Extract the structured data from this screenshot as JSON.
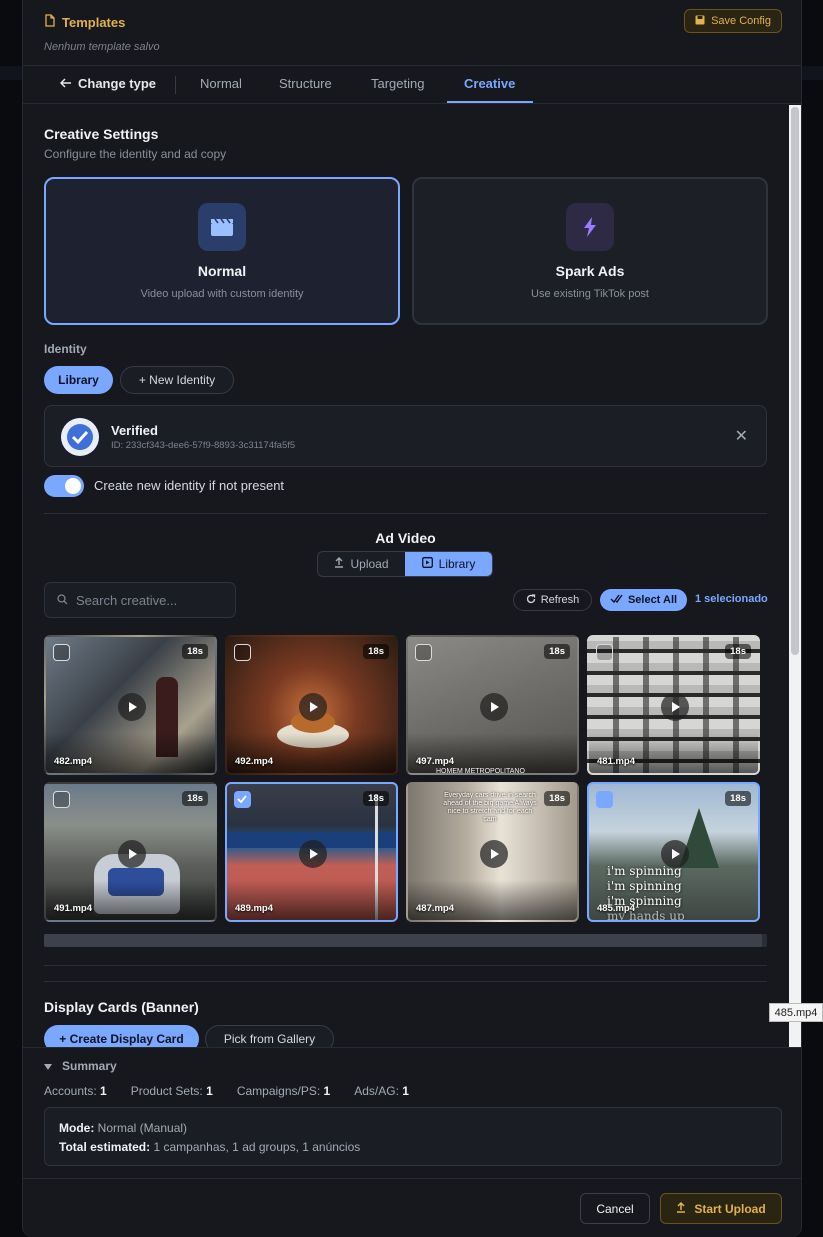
{
  "templates": {
    "title": "Templates",
    "subtitle": "Nenhum template salvo",
    "save_label": "Save Config"
  },
  "tabs": {
    "back_label": "Change type",
    "items": [
      "Normal",
      "Structure",
      "Targeting",
      "Creative"
    ],
    "active": "Creative"
  },
  "creative": {
    "title": "Creative Settings",
    "subtitle": "Configure the identity and ad copy",
    "modes": [
      {
        "name": "Normal",
        "desc": "Video upload with custom identity",
        "icon": "clapperboard-icon",
        "selected": true
      },
      {
        "name": "Spark Ads",
        "desc": "Use existing TikTok post",
        "icon": "lightning-icon",
        "selected": false
      }
    ]
  },
  "identity": {
    "label": "Identity",
    "library_label": "Library",
    "new_label": "+ New Identity",
    "name": "Verified",
    "id_text": "ID: 233cf343-dee6-57f9-8893-3c31174fa5f5",
    "toggle_label": "Create new identity if not present",
    "toggle_on": true
  },
  "ad_video": {
    "title": "Ad Video",
    "upload_label": "Upload",
    "library_label": "Library",
    "search_placeholder": "Search creative...",
    "refresh_label": "Refresh",
    "select_all_label": "Select All",
    "selected_count": "1 selecionado",
    "videos": [
      {
        "name": "482.mp4",
        "duration": "18s",
        "selected": false
      },
      {
        "name": "492.mp4",
        "duration": "18s",
        "selected": false
      },
      {
        "name": "497.mp4",
        "duration": "18s",
        "selected": false
      },
      {
        "name": "481.mp4",
        "duration": "18s",
        "selected": false
      },
      {
        "name": "491.mp4",
        "duration": "18s",
        "selected": false
      },
      {
        "name": "489.mp4",
        "duration": "18s",
        "selected": true
      },
      {
        "name": "487.mp4",
        "duration": "18s",
        "selected": false
      },
      {
        "name": "485.mp4",
        "duration": "18s",
        "selected": false
      }
    ],
    "overlay_text": {
      "i_am_spinning": [
        "i'm spinning",
        "i'm spinning",
        "i'm spinning",
        "my hands up"
      ],
      "blurry_caption": "Everyday cars drive in search ahead of the big game Always nice to stretch and for each cam",
      "tile_497": "HOMEM METROPOLITANO"
    },
    "tooltip": "485.mp4"
  },
  "display_cards": {
    "title": "Display Cards (Banner)",
    "create_label": "+ Create Display Card",
    "gallery_label": "Pick from Gallery"
  },
  "summary": {
    "title": "Summary",
    "stats": [
      {
        "label": "Accounts:",
        "value": "1"
      },
      {
        "label": "Product Sets:",
        "value": "1"
      },
      {
        "label": "Campaigns/PS:",
        "value": "1"
      },
      {
        "label": "Ads/AG:",
        "value": "1"
      }
    ],
    "mode_label": "Mode:",
    "mode_value": "Normal (Manual)",
    "total_label": "Total estimated:",
    "total_value": "1 campanhas, 1 ad groups, 1 anúncios"
  },
  "footer": {
    "cancel_label": "Cancel",
    "start_label": "Start Upload"
  },
  "colors": {
    "accent": "#7aa7ff",
    "gold": "#e2b24b",
    "panel": "#16181e"
  }
}
